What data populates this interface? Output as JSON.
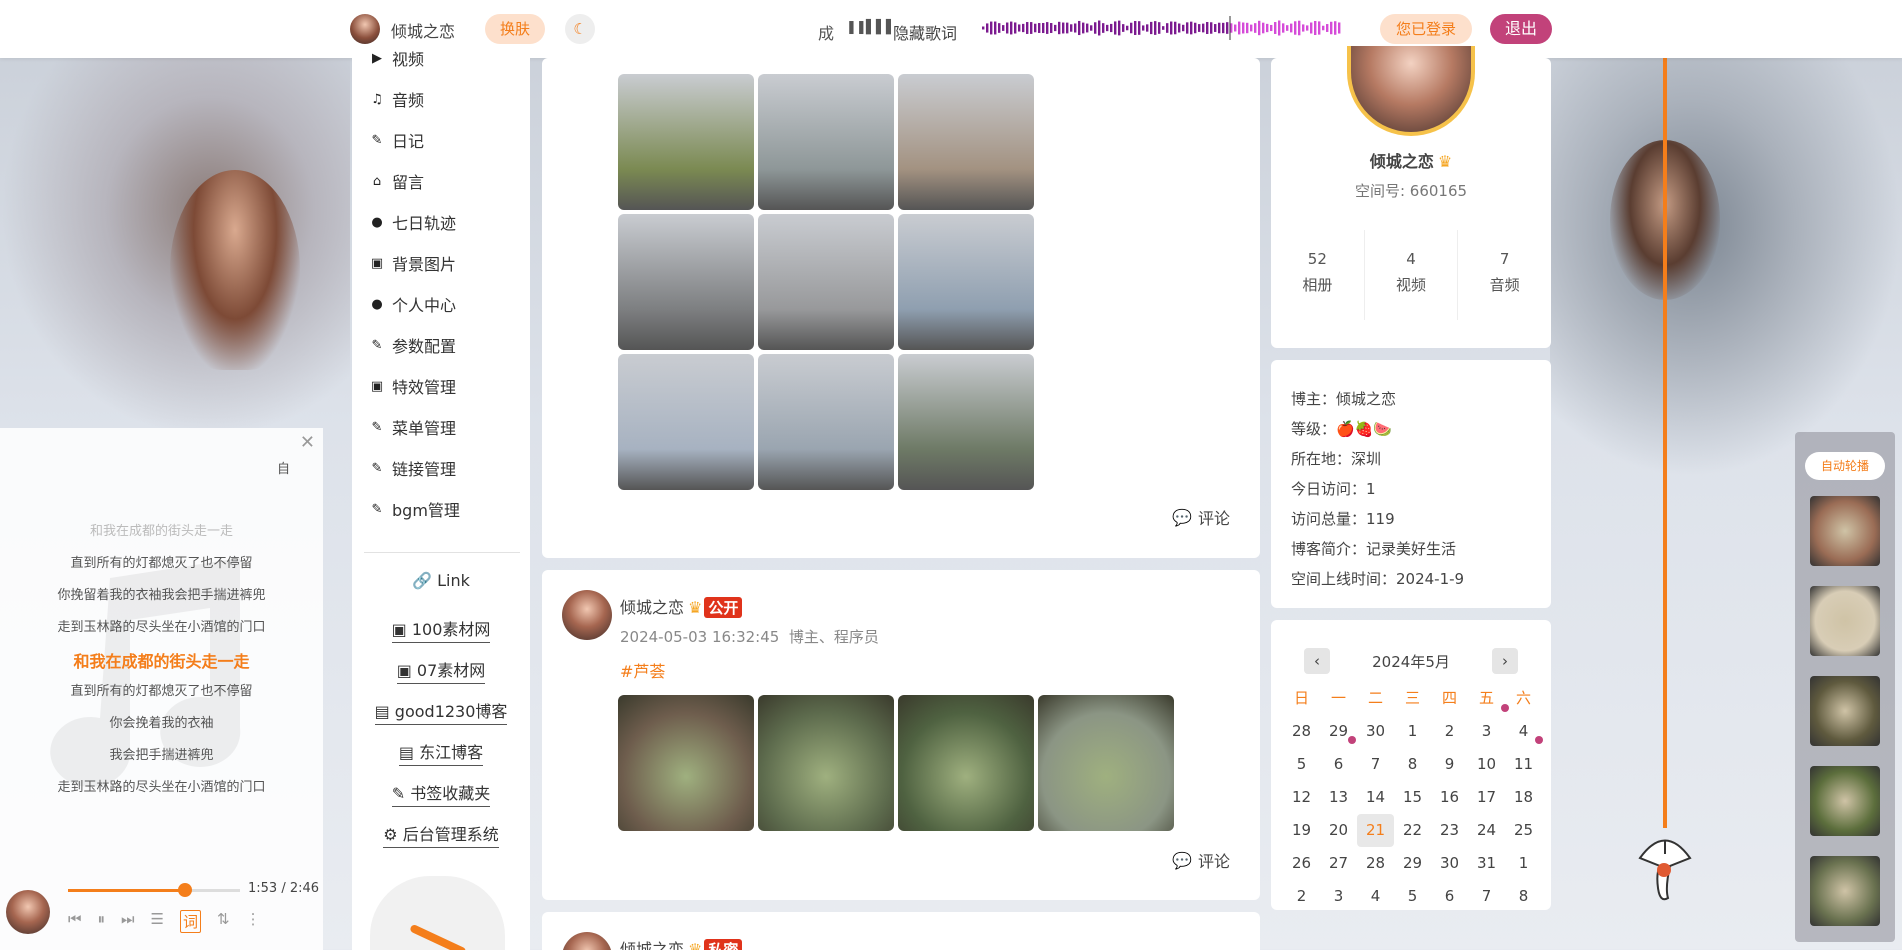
{
  "topbar": {
    "username": "倾城之恋",
    "skin_button": "换肤",
    "moon_icon": "☾",
    "lyric_snippet": "成",
    "pause_icon": "❚❚",
    "bars_icon": "▌▌▌",
    "hide_lyrics": "隐藏歌词",
    "logged_in": "您已登录",
    "logout": "退出"
  },
  "nav": {
    "items": [
      {
        "icon": "▶",
        "label": "视频"
      },
      {
        "icon": "♫",
        "label": "音频"
      },
      {
        "icon": "✎",
        "label": "日记"
      },
      {
        "icon": "⌂",
        "label": "留言"
      },
      {
        "icon": "●",
        "label": "七日轨迹"
      },
      {
        "icon": "▣",
        "label": "背景图片"
      },
      {
        "icon": "●",
        "label": "个人中心"
      },
      {
        "icon": "✎",
        "label": "参数配置"
      },
      {
        "icon": "▣",
        "label": "特效管理"
      },
      {
        "icon": "✎",
        "label": "菜单管理"
      },
      {
        "icon": "✎",
        "label": "链接管理"
      },
      {
        "icon": "✎",
        "label": "bgm管理"
      }
    ],
    "link_title": "Link",
    "link_icon": "🔗",
    "links": [
      {
        "icon": "▣",
        "label": "100素材网"
      },
      {
        "icon": "▣",
        "label": "07素材网"
      },
      {
        "icon": "▤",
        "label": "good1230博客"
      },
      {
        "icon": "▤",
        "label": "东江博客"
      },
      {
        "icon": "✎",
        "label": "书签收藏夹"
      },
      {
        "icon": "⚙",
        "label": "后台管理系统"
      }
    ]
  },
  "posts": [
    {
      "comment": "评论",
      "photos": [
        "#7b8a52",
        "#8e9798",
        "#a39281",
        "#7d7f81",
        "#98999b",
        "#8f9fb0",
        "#a7b2c1",
        "#9aa5b0",
        "#6e7a66"
      ]
    },
    {
      "author": "倾城之恋",
      "crown": "♛",
      "visibility": "公开",
      "date": "2024-05-03 16:32:45",
      "role": "博主、程序员",
      "tag": "#芦荟",
      "comment": "评论",
      "photos": [
        "#6e5d4d",
        "#5d6b4d",
        "#4f6241",
        "#8b9584"
      ]
    },
    {
      "author": "倾城之恋",
      "crown": "♛",
      "visibility": "私密"
    }
  ],
  "profile": {
    "name": "倾城之恋",
    "crown": "♛",
    "space_id": "空间号: 660165",
    "stats": [
      {
        "value": "52",
        "label": "相册"
      },
      {
        "value": "4",
        "label": "视频"
      },
      {
        "value": "7",
        "label": "音频"
      }
    ]
  },
  "info": {
    "rows": [
      "博主：倾城之恋",
      "等级：🍎🍓🍉",
      "所在地：深圳",
      "今日访问：1",
      "访问总量：119",
      "博客简介：记录美好生活",
      "空间上线时间：2024-1-9"
    ]
  },
  "calendar": {
    "title": "2024年5月",
    "prev": "‹",
    "next": "›",
    "weekdays": [
      "日",
      "一",
      "二",
      "三",
      "四",
      "五",
      "六"
    ],
    "days": [
      "28",
      "29",
      "30",
      "1",
      "2",
      "3",
      "4",
      "5",
      "6",
      "7",
      "8",
      "9",
      "10",
      "11",
      "12",
      "13",
      "14",
      "15",
      "16",
      "17",
      "18",
      "19",
      "20",
      "21",
      "22",
      "23",
      "24",
      "25",
      "26",
      "27",
      "28",
      "29",
      "30",
      "31",
      "1",
      "2",
      "3",
      "4",
      "5",
      "6",
      "7",
      "8"
    ],
    "today": "21"
  },
  "carousel": {
    "button": "自动轮播",
    "thumbs": [
      "#9a6c55",
      "#d8cdb6",
      "#5f5a3e",
      "#5c6e3c",
      "#6a7250"
    ]
  },
  "lyrics": {
    "side": "自",
    "lines": [
      "和我在成都的街头走一走",
      "直到所有的灯都熄灭了也不停留",
      "你挽留着我的衣袖我会把手揣进裤兜",
      "走到玉林路的尽头坐在小酒馆的门口",
      "和我在成都的街头走一走",
      "直到所有的灯都熄灭了也不停留",
      "你会挽着我的衣袖",
      "我会把手揣进裤兜",
      "走到玉林路的尽头坐在小酒馆的门口"
    ],
    "active_index": 4,
    "time": "1:53 / 2:46",
    "progress": 0.68
  }
}
